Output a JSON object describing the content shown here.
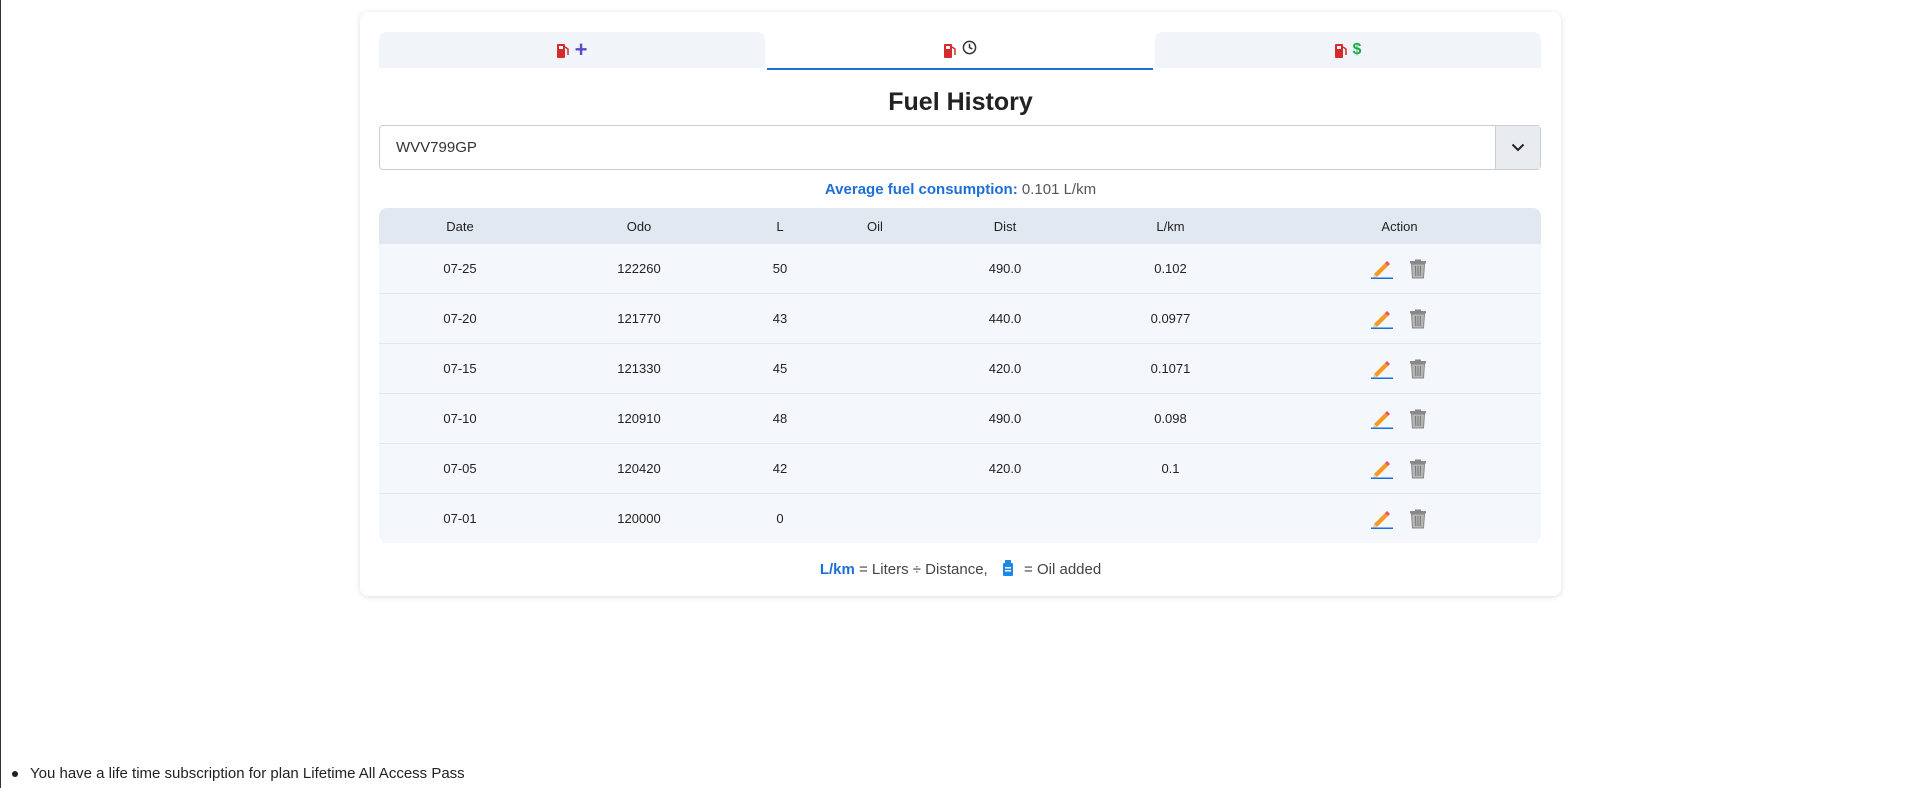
{
  "tabs": [
    {
      "name": "add-fuel",
      "icons": [
        "fuel-pump-icon",
        "plus-icon"
      ],
      "active": false
    },
    {
      "name": "fuel-history",
      "icons": [
        "fuel-pump-icon",
        "clock-icon"
      ],
      "active": true
    },
    {
      "name": "fuel-cost",
      "icons": [
        "fuel-pump-icon",
        "dollar-icon"
      ],
      "active": false
    }
  ],
  "page_title": "Fuel History",
  "vehicle_select": {
    "value": "WVV799GP"
  },
  "average": {
    "label": "Average fuel consumption:",
    "value": "0.101 L/km"
  },
  "table": {
    "headers": [
      "Date",
      "Odo",
      "L",
      "Oil",
      "Dist",
      "L/km",
      "Action"
    ],
    "rows": [
      {
        "date": "07-25",
        "odo": "122260",
        "liters": "50",
        "oil": "",
        "dist": "490.0",
        "lkm": "0.102"
      },
      {
        "date": "07-20",
        "odo": "121770",
        "liters": "43",
        "oil": "",
        "dist": "440.0",
        "lkm": "0.0977"
      },
      {
        "date": "07-15",
        "odo": "121330",
        "liters": "45",
        "oil": "",
        "dist": "420.0",
        "lkm": "0.1071"
      },
      {
        "date": "07-10",
        "odo": "120910",
        "liters": "48",
        "oil": "",
        "dist": "490.0",
        "lkm": "0.098"
      },
      {
        "date": "07-05",
        "odo": "120420",
        "liters": "42",
        "oil": "",
        "dist": "420.0",
        "lkm": "0.1"
      },
      {
        "date": "07-01",
        "odo": "120000",
        "liters": "0",
        "oil": "",
        "dist": "",
        "lkm": ""
      }
    ]
  },
  "legend": {
    "lkm": "L/km",
    "lkm_desc": "= Liters ÷ Distance,",
    "oil_desc": "= Oil added"
  },
  "subscription_note": "You have a life time subscription for plan Lifetime All Access Pass",
  "colors": {
    "accent": "#1d6fd8",
    "pump": "#d62b2b",
    "plus": "#5b4bc4",
    "dollar": "#1faa4a"
  }
}
